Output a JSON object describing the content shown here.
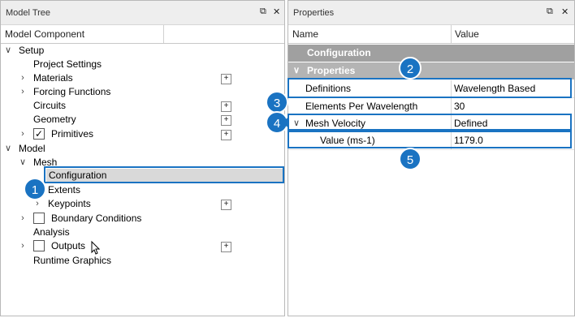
{
  "model_tree": {
    "title": "Model Tree",
    "column_header": "Model Component",
    "items": [
      {
        "label": "Setup",
        "chevron": "down"
      },
      {
        "label": "Project Settings"
      },
      {
        "label": "Materials",
        "chevron": "right",
        "plus": "+"
      },
      {
        "label": "Forcing Functions",
        "chevron": "right"
      },
      {
        "label": "Circuits",
        "plus": "+"
      },
      {
        "label": "Geometry",
        "plus": "+"
      },
      {
        "label": "Primitives",
        "chevron": "right",
        "checkbox": "✓",
        "plus": "+"
      },
      {
        "label": "Model",
        "chevron": "down"
      },
      {
        "label": "Mesh",
        "chevron": "down"
      },
      {
        "label": "Configuration",
        "selected": true
      },
      {
        "label": "Extents"
      },
      {
        "label": "Keypoints",
        "chevron": "right",
        "plus": "+"
      },
      {
        "label": "Boundary Conditions",
        "chevron": "right",
        "checkbox": ""
      },
      {
        "label": "Analysis"
      },
      {
        "label": "Outputs",
        "chevron": "right",
        "checkbox": "",
        "plus": "+"
      },
      {
        "label": "Runtime Graphics"
      }
    ]
  },
  "properties": {
    "title": "Properties",
    "col_name": "Name",
    "col_value": "Value",
    "section": "Configuration",
    "subsection": "Properties",
    "rows": [
      {
        "name": "Definitions",
        "value": "Wavelength Based"
      },
      {
        "name": "Elements Per Wavelength",
        "value": "30"
      },
      {
        "name": "Mesh Velocity",
        "value": "Defined"
      },
      {
        "name": "Value (ms-1)",
        "value": "1179.0"
      }
    ]
  },
  "window_icons": {
    "pin": "⧉",
    "close": "✕"
  },
  "chevrons": {
    "down": "∨",
    "right": "›"
  },
  "callouts": [
    "1",
    "2",
    "3",
    "4",
    "5"
  ],
  "colors": {
    "accent": "#1a73c2",
    "section_bg": "#a0a0a0",
    "selected_bg": "#d9d9d9"
  }
}
